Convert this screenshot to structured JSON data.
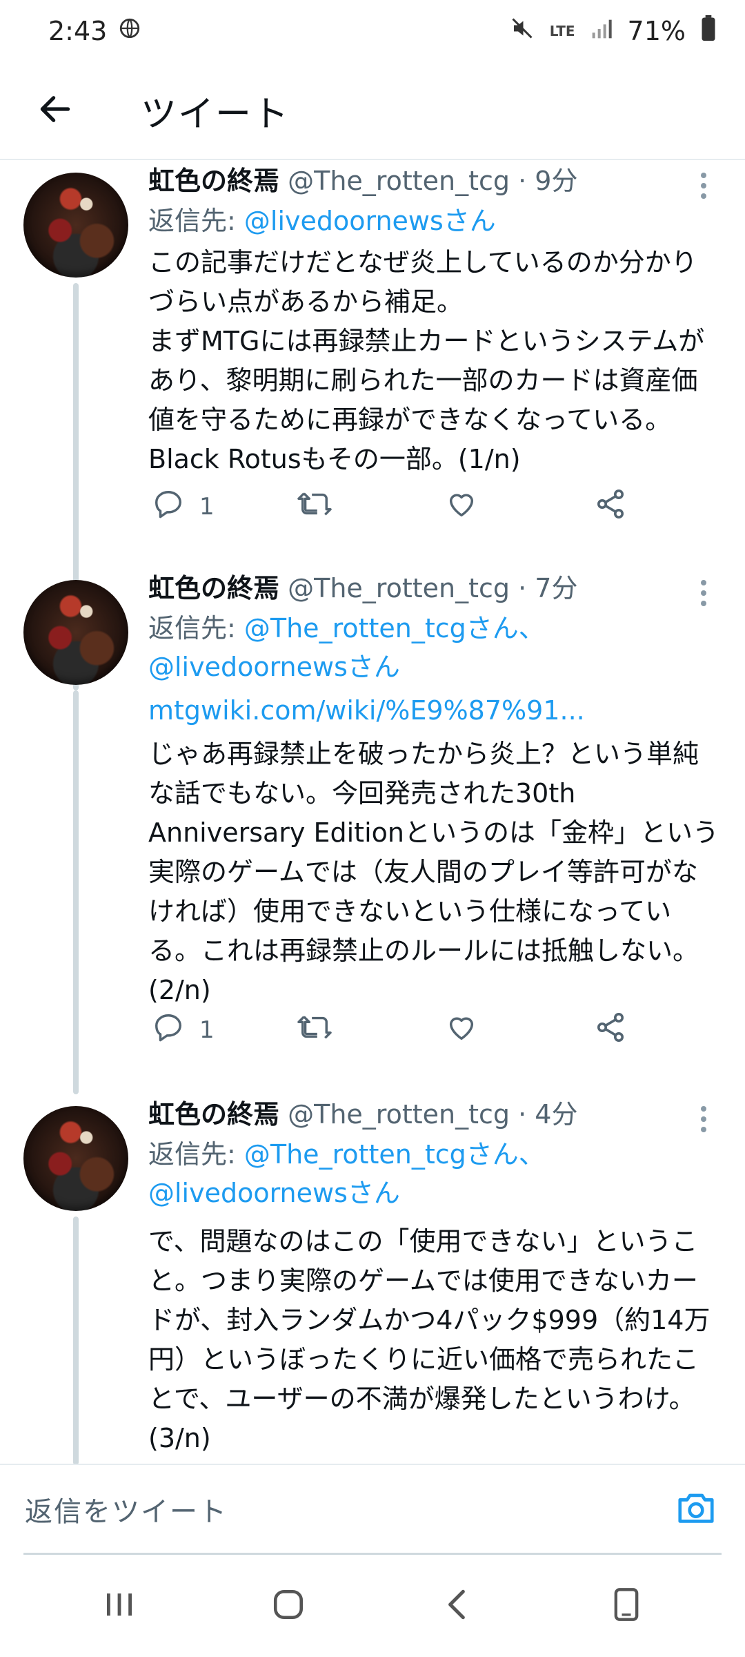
{
  "status_bar": {
    "time": "2:43",
    "network": "LTE",
    "battery": "71%"
  },
  "header": {
    "title": "ツイート"
  },
  "tweets": [
    {
      "author": "虹色の終焉",
      "handle": "@The_rotten_tcg",
      "dot": "·",
      "time": "9分",
      "reply_prefix": "返信先: ",
      "mentions_line1": "@livedoornewsさん",
      "mentions_line2": "",
      "link": "",
      "text": "この記事だけだとなぜ炎上しているのか分かりづらい点があるから補足。\nまずMTGには再録禁止カードというシステムがあり、黎明期に刷られた一部のカードは資産価値を守るために再録ができなくなっている。Black Rotusもその一部。(1/n)",
      "reply_count": "1"
    },
    {
      "author": "虹色の終焉",
      "handle": "@The_rotten_tcg",
      "dot": "·",
      "time": "7分",
      "reply_prefix": "返信先: ",
      "mentions_line1": "@The_rotten_tcgさん、",
      "mentions_line2": "@livedoornewsさん",
      "link": "mtgwiki.com/wiki/%E9%87%91...",
      "text": "じゃあ再録禁止を破ったから炎上？という単純な話でもない。今回発売された30th Anniversary Editionというのは「金枠」という実際のゲームでは（友人間のプレイ等許可がなければ）使用できないという仕様になっている。これは再録禁止のルールには抵触しない。(2/n)",
      "reply_count": "1"
    },
    {
      "author": "虹色の終焉",
      "handle": "@The_rotten_tcg",
      "dot": "·",
      "time": "4分",
      "reply_prefix": "返信先: ",
      "mentions_line1": "@The_rotten_tcgさん、",
      "mentions_line2": "@livedoornewsさん",
      "link": "",
      "text": "で、問題なのはこの「使用できない」ということ。つまり実際のゲームでは使用できないカードが、封入ランダムかつ4パック$999（約14万円）というぼったくりに近い価格で売られたことで、ユーザーの不満が爆発したというわけ。(3/n)",
      "reply_count": ""
    }
  ],
  "reply_bar": {
    "placeholder": "返信をツイート"
  },
  "colors": {
    "accent": "#1d9bf0",
    "muted": "#536471",
    "text": "#0f1419",
    "divider": "#e6ecf0"
  },
  "icons": [
    "back-arrow-icon",
    "reply-icon",
    "retweet-icon",
    "like-icon",
    "share-icon",
    "more-icon",
    "camera-icon",
    "recents-icon",
    "home-icon",
    "nav-back-icon",
    "rotate-icon",
    "globe-icon",
    "mute-icon",
    "signal-icon",
    "battery-icon"
  ]
}
